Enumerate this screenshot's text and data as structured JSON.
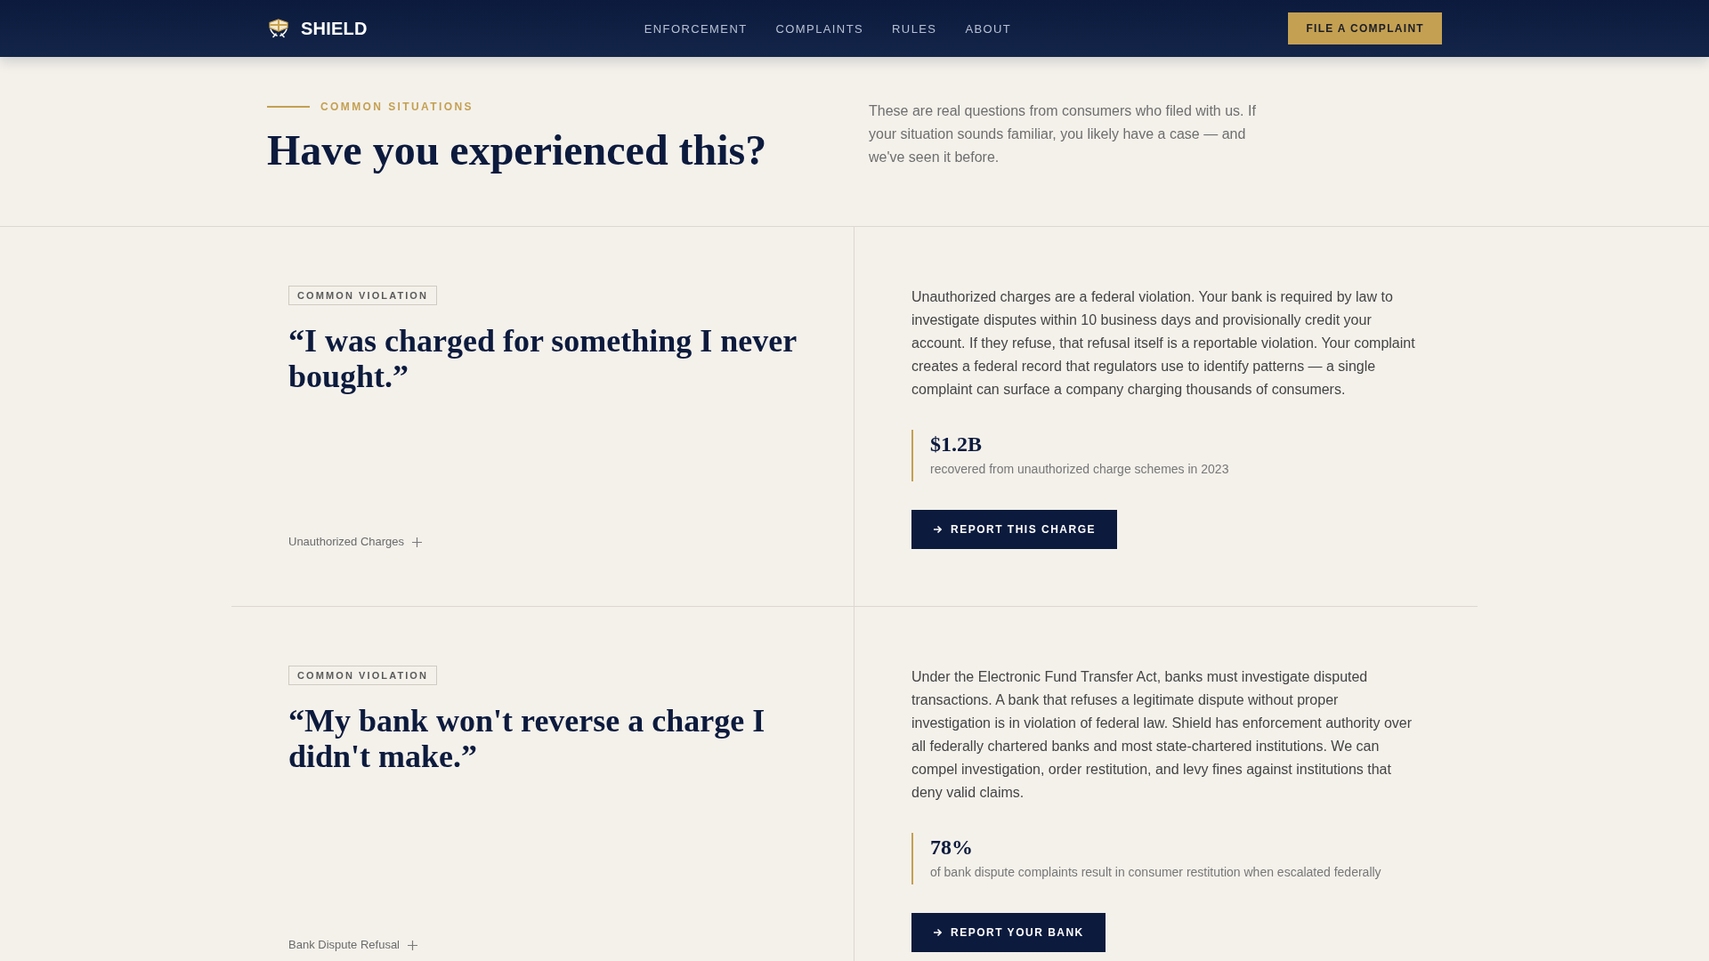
{
  "header": {
    "brand": "SHIELD",
    "nav": [
      "ENFORCEMENT",
      "COMPLAINTS",
      "RULES",
      "ABOUT"
    ],
    "cta": "FILE A COMPLAINT"
  },
  "intro": {
    "eyebrow": "COMMON SITUATIONS",
    "title": "Have you experienced this?",
    "description": "These are real questions from consumers who filed with us. If your situation sounds familiar, you likely have a case — and we've seen it before."
  },
  "cases": [
    {
      "tag": "COMMON VIOLATION",
      "quote": "“I was charged for something I never bought.”",
      "category": "Unauthorized Charges",
      "body": "Unauthorized charges are a federal violation. Your bank is required by law to investigate disputes within 10 business days and provisionally credit your account. If they refuse, that refusal itself is a reportable violation. Your complaint creates a federal record that regulators use to identify patterns — a single complaint can surface a company charging thousands of consumers.",
      "stat": {
        "value": "$1.2B",
        "label": "recovered from unauthorized charge schemes in 2023"
      },
      "action": "REPORT THIS CHARGE"
    },
    {
      "tag": "COMMON VIOLATION",
      "quote": "“My bank won't reverse a charge I didn't make.”",
      "category": "Bank Dispute Refusal",
      "body": "Under the Electronic Fund Transfer Act, banks must investigate disputed transactions. A bank that refuses a legitimate dispute without proper investigation is in violation of federal law. Shield has enforcement authority over all federally chartered banks and most state-chartered institutions. We can compel investigation, order restitution, and levy fines against institutions that deny valid claims.",
      "stat": {
        "value": "78%",
        "label": "of bank dispute complaints result in consumer restitution when escalated federally"
      },
      "action": "REPORT YOUR BANK"
    }
  ]
}
